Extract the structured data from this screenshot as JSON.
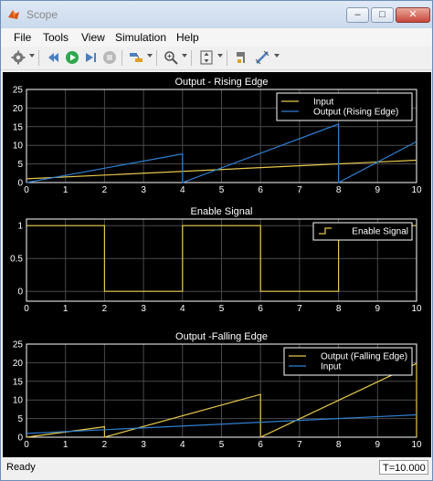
{
  "window": {
    "title": "Scope"
  },
  "menu": [
    "File",
    "Tools",
    "View",
    "Simulation",
    "Help"
  ],
  "toolbar": {
    "icons": [
      "gear-icon",
      "rewind-icon",
      "run-icon",
      "step-forward-icon",
      "stop-icon",
      "highlight-icon",
      "zoom-icon",
      "fit-icon",
      "style-icon",
      "cursor-measure-icon"
    ]
  },
  "status": {
    "left": "Ready",
    "time": "T=10.000"
  },
  "colors": {
    "input": "#e6c74c",
    "output": "#2f7fd2",
    "axes": "#ffffff",
    "grid": "#4a4a4a"
  },
  "chart_data": [
    {
      "type": "line",
      "title": "Output - Rising Edge",
      "xlim": [
        0,
        10
      ],
      "ylim": [
        0,
        25
      ],
      "xticks": [
        0,
        1,
        2,
        3,
        4,
        5,
        6,
        7,
        8,
        9,
        10
      ],
      "yticks": [
        0,
        5,
        10,
        15,
        20,
        25
      ],
      "legend": "top-right",
      "series": [
        {
          "name": "Input",
          "color": "#e6c74c",
          "x": [
            0,
            10
          ],
          "y": [
            1,
            6
          ]
        },
        {
          "name": "Output (Rising Edge)",
          "color": "#2f7fd2",
          "x": [
            0,
            4,
            4,
            8,
            8,
            10
          ],
          "y": [
            0,
            7.7,
            0,
            15.7,
            0,
            11
          ]
        }
      ]
    },
    {
      "type": "line",
      "title": "Enable Signal",
      "xlim": [
        0,
        10
      ],
      "ylim": [
        -0.15,
        1.1
      ],
      "xticks": [
        0,
        1,
        2,
        3,
        4,
        5,
        6,
        7,
        8,
        9,
        10
      ],
      "yticks": [
        0,
        0.5,
        1
      ],
      "legend": "top-right",
      "series": [
        {
          "name": "Enable Signal",
          "color": "#e6c74c",
          "x": [
            0,
            2,
            2,
            4,
            4,
            6,
            6,
            8,
            8,
            10
          ],
          "y": [
            1,
            1,
            0,
            0,
            1,
            1,
            0,
            0,
            1,
            1
          ]
        }
      ]
    },
    {
      "type": "line",
      "title": "Output -Falling Edge",
      "xlim": [
        0,
        10
      ],
      "ylim": [
        0,
        25
      ],
      "xticks": [
        0,
        1,
        2,
        3,
        4,
        5,
        6,
        7,
        8,
        9,
        10
      ],
      "yticks": [
        0,
        5,
        10,
        15,
        20,
        25
      ],
      "legend": "top-right",
      "series": [
        {
          "name": "Output (Falling Edge)",
          "color": "#e6c74c",
          "x": [
            0,
            2,
            2,
            6,
            6,
            10,
            10
          ],
          "y": [
            0,
            2.8,
            0,
            11.5,
            0,
            19.8,
            0
          ]
        },
        {
          "name": "Input",
          "color": "#2f7fd2",
          "x": [
            0,
            10
          ],
          "y": [
            1,
            6
          ]
        }
      ]
    }
  ]
}
